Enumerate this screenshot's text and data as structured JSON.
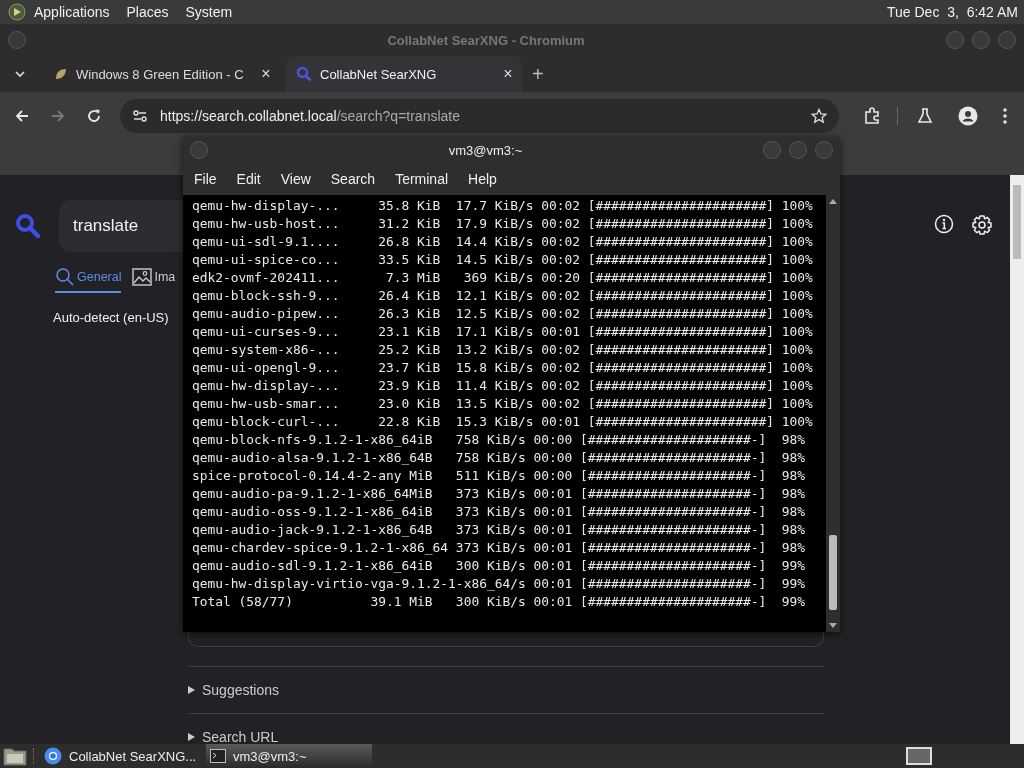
{
  "top_panel": {
    "menus": [
      "Applications",
      "Places",
      "System"
    ],
    "clock": "Tue Dec  3,  6:42 AM"
  },
  "browser": {
    "title": "CollabNet SearXNG - Chromium",
    "tabs": [
      {
        "title": "Windows 8 Green Edition - C",
        "selected": false,
        "close": "×",
        "kind": "leaf"
      },
      {
        "title": "CollabNet SearXNG",
        "selected": true,
        "close": "×",
        "kind": "search"
      }
    ],
    "new_tab": "+",
    "forward_disabled": true,
    "address": {
      "origin": "https://search.collabnet.local",
      "path": "/search?q=translate"
    },
    "page": {
      "search": {
        "value": "translate"
      },
      "categories": [
        {
          "label": "General",
          "selected": true,
          "kind": "search"
        },
        {
          "label": "Ima",
          "selected": false,
          "kind": "image"
        }
      ],
      "language": "Auto-detect (en-US)",
      "sections": [
        {
          "label": "Suggestions",
          "expanded": false
        },
        {
          "label": "Search URL",
          "expanded": false
        }
      ]
    }
  },
  "terminal": {
    "title": "vm3@vm3:~",
    "menus": [
      "File",
      "Edit",
      "View",
      "Search",
      "Terminal",
      "Help"
    ],
    "lines": [
      "qemu-hw-display-...     35.8 KiB  17.7 KiB/s 00:02 [######################] 100%",
      "qemu-hw-usb-host...     31.2 KiB  17.9 KiB/s 00:02 [######################] 100%",
      "qemu-ui-sdl-9.1....     26.8 KiB  14.4 KiB/s 00:02 [######################] 100%",
      "qemu-ui-spice-co...     33.5 KiB  14.5 KiB/s 00:02 [######################] 100%",
      "edk2-ovmf-202411...      7.3 MiB   369 KiB/s 00:20 [######################] 100%",
      "qemu-block-ssh-9...     26.4 KiB  12.1 KiB/s 00:02 [######################] 100%",
      "qemu-audio-pipew...     26.3 KiB  12.5 KiB/s 00:02 [######################] 100%",
      "qemu-ui-curses-9...     23.1 KiB  17.1 KiB/s 00:01 [######################] 100%",
      "qemu-system-x86-...     25.2 KiB  13.2 KiB/s 00:02 [######################] 100%",
      "qemu-ui-opengl-9...     23.7 KiB  15.8 KiB/s 00:02 [######################] 100%",
      "qemu-hw-display-...     23.9 KiB  11.4 KiB/s 00:02 [######################] 100%",
      "qemu-hw-usb-smar...     23.0 KiB  13.5 KiB/s 00:02 [######################] 100%",
      "qemu-block-curl-...     22.8 KiB  15.3 KiB/s 00:01 [######################] 100%",
      "qemu-block-nfs-9.1.2-1-x86_64iB   758 KiB/s 00:00 [#####################-]  98%",
      "qemu-audio-alsa-9.1.2-1-x86_64B   758 KiB/s 00:00 [#####################-]  98%",
      "spice-protocol-0.14.4-2-any MiB   511 KiB/s 00:00 [#####################-]  98%",
      "qemu-audio-pa-9.1.2-1-x86_64MiB   373 KiB/s 00:01 [#####################-]  98%",
      "qemu-audio-oss-9.1.2-1-x86_64iB   373 KiB/s 00:01 [#####################-]  98%",
      "qemu-audio-jack-9.1.2-1-x86_64B   373 KiB/s 00:01 [#####################-]  98%",
      "qemu-chardev-spice-9.1.2-1-x86_64 373 KiB/s 00:01 [#####################-]  98%",
      "qemu-audio-sdl-9.1.2-1-x86_64iB   300 KiB/s 00:01 [#####################-]  99%",
      "qemu-hw-display-virtio-vga-9.1.2-1-x86_64/s 00:01 [#####################-]  99%",
      "Total (58/77)          39.1 MiB   300 KiB/s 00:01 [#####################-]  99%"
    ]
  },
  "taskbar": {
    "items": [
      {
        "label": "CollabNet SearXNG...",
        "kind": "browser",
        "selected": false
      },
      {
        "label": "vm3@vm3:~",
        "kind": "terminal",
        "selected": true
      }
    ]
  }
}
